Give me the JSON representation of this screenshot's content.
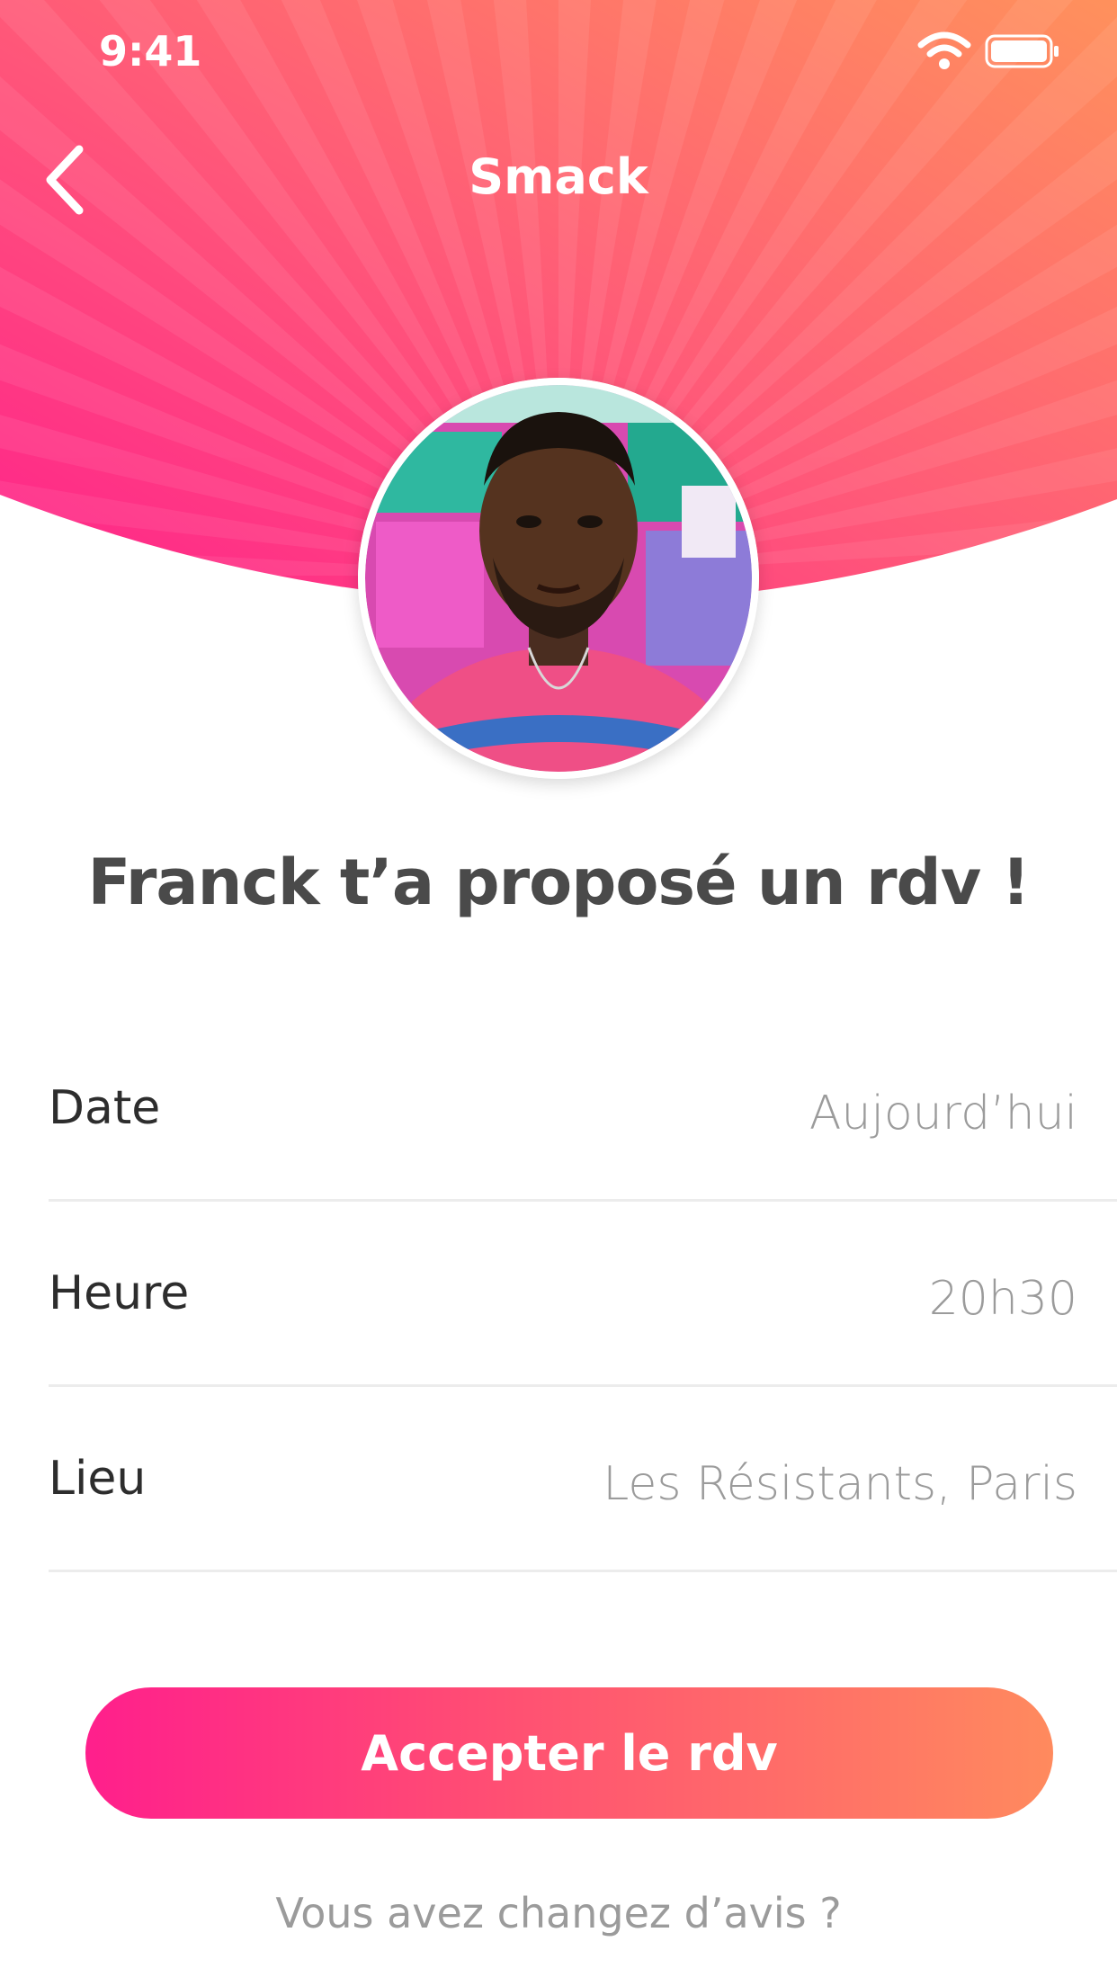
{
  "status_bar": {
    "time": "9:41",
    "wifi_icon": "wifi-icon",
    "battery_icon": "battery-icon"
  },
  "nav": {
    "back_icon": "chevron-left-icon",
    "title": "Smack"
  },
  "profile": {
    "avatar_icon": "profile-photo"
  },
  "headline": "Franck t’a proposé un rdv !",
  "details": [
    {
      "label": "Date",
      "value": "Aujourd’hui"
    },
    {
      "label": "Heure",
      "value": "20h30"
    },
    {
      "label": "Lieu",
      "value": "Les Résistants, Paris"
    }
  ],
  "actions": {
    "accept_label": "Accepter le rdv",
    "change_mind_label": "Vous avez changez d’avis ?"
  },
  "colors": {
    "gradient_start": "#ff1f8c",
    "gradient_end": "#ff8a5e",
    "headline": "#4a4a4a",
    "value_text": "#9b9b9b"
  }
}
